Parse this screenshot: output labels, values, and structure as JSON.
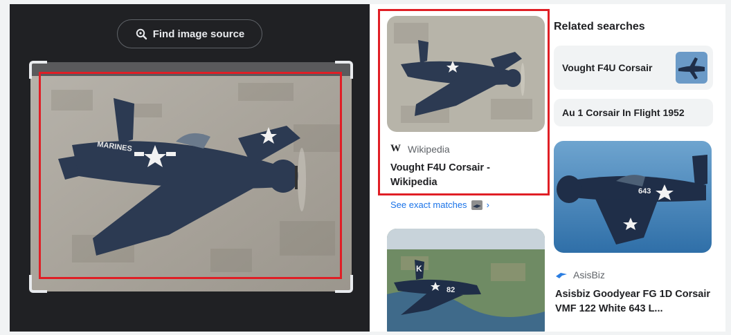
{
  "left": {
    "find_button_label": "Find image source"
  },
  "results": {
    "first": {
      "source_icon": "W",
      "source": "Wikipedia",
      "title": "Vought F4U Corsair - Wikipedia"
    },
    "see_exact_label": "See exact matches",
    "see_exact_arrow": "›",
    "second": {
      "source": "AsisBiz",
      "title": "Asisbiz Goodyear FG 1D Corsair VMF 122 White 643 L..."
    }
  },
  "related": {
    "heading": "Related searches",
    "items": [
      "Vought F4U Corsair",
      "Au 1 Corsair In Flight 1952"
    ]
  },
  "image_text": {
    "marines": "MARINES",
    "tail_code": "K",
    "plane_number": "82",
    "plane_number_2": "643"
  },
  "colors": {
    "highlight": "#e01e25",
    "link": "#1a73e8",
    "dark_bg": "#202124"
  }
}
